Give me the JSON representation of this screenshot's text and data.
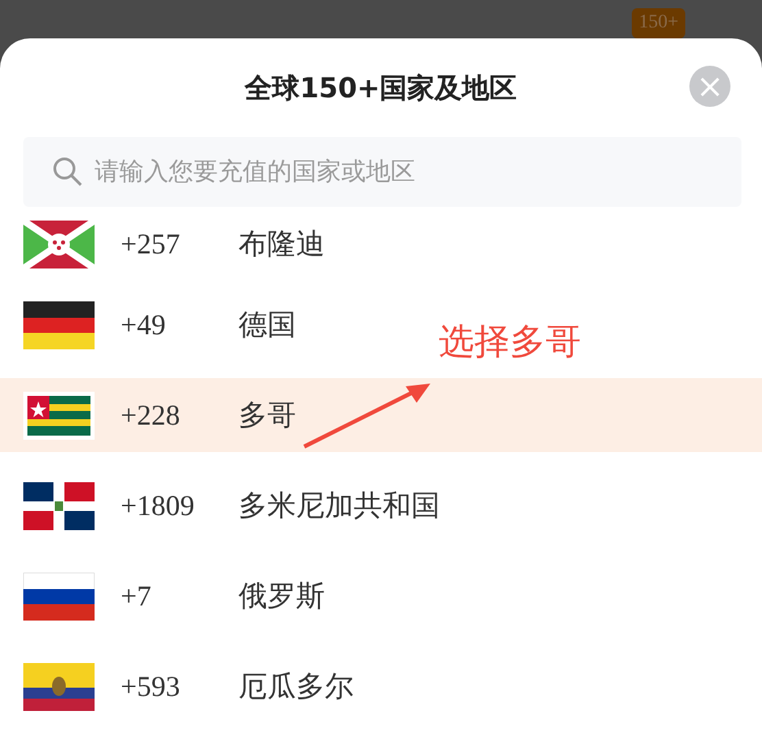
{
  "background": {
    "badge": "150+"
  },
  "dialog": {
    "title": "全球150+国家及地区",
    "close_label": "×"
  },
  "search": {
    "placeholder": "请输入您要充值的国家或地区"
  },
  "countries": [
    {
      "code": "+257",
      "name": "布隆迪",
      "selected": false
    },
    {
      "code": "+49",
      "name": "德国",
      "selected": false
    },
    {
      "code": "+228",
      "name": "多哥",
      "selected": true
    },
    {
      "code": "+1809",
      "name": "多米尼加共和国",
      "selected": false
    },
    {
      "code": "+7",
      "name": "俄罗斯",
      "selected": false
    },
    {
      "code": "+593",
      "name": "厄瓜多尔",
      "selected": false
    }
  ],
  "annotation": {
    "text": "选择多哥"
  }
}
